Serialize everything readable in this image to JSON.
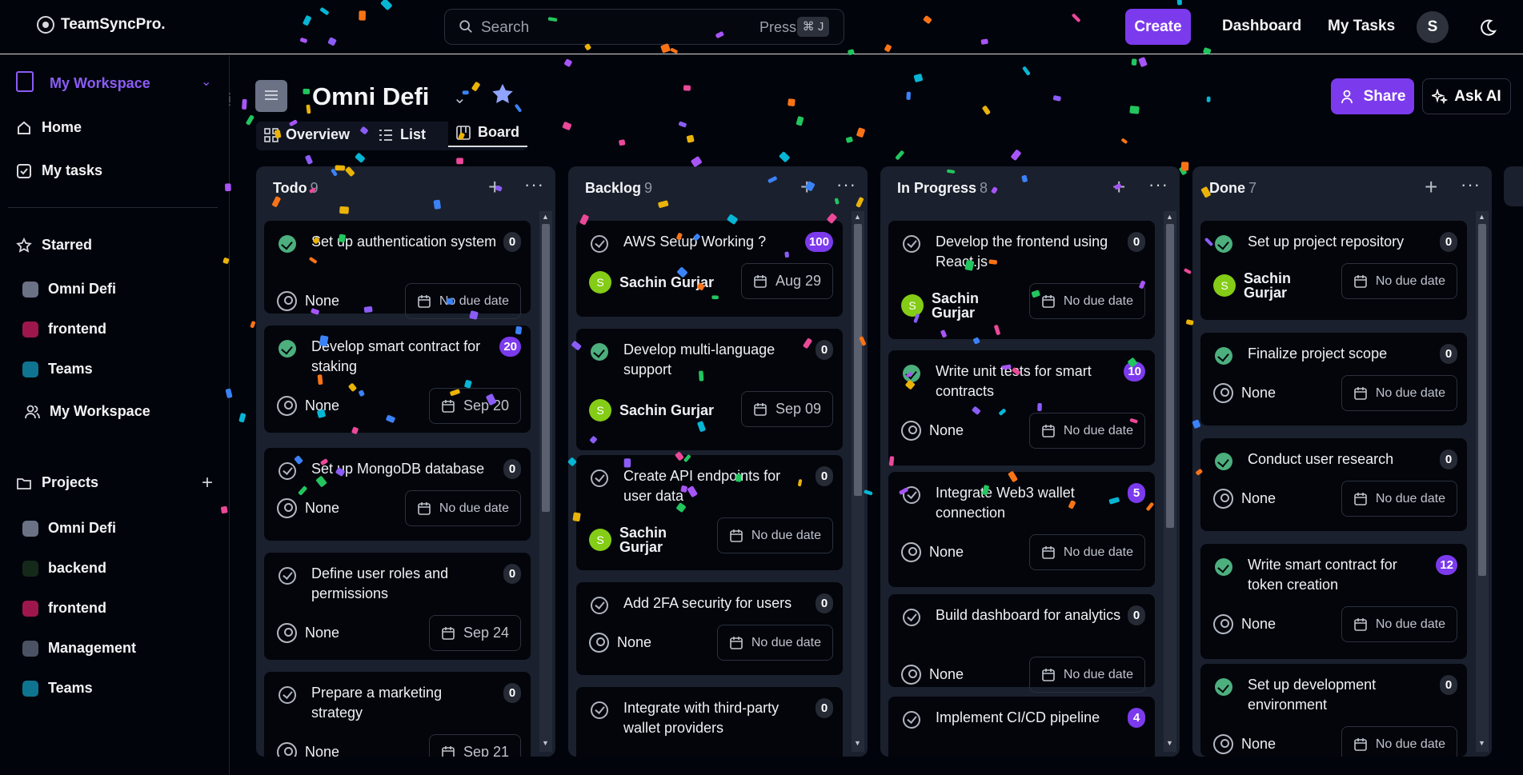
{
  "topbar": {
    "brand": "TeamSyncPro.",
    "search_placeholder": "Search",
    "press_label": "Press",
    "shortcut": "⌘ J",
    "create_label": "Create",
    "dashboard_label": "Dashboard",
    "my_tasks_label": "My Tasks",
    "avatar_initial": "S"
  },
  "sidebar": {
    "workspace_label": "My Workspace",
    "home_label": "Home",
    "my_tasks_label": "My tasks",
    "starred_label": "Starred",
    "starred_items": [
      {
        "label": "Omni Defi",
        "color": "#6b7286"
      },
      {
        "label": "frontend",
        "color": "#9d174d"
      },
      {
        "label": "Teams",
        "color": "#0e7490"
      }
    ],
    "my_workspace_label": "My Workspace",
    "projects_label": "Projects",
    "projects": [
      {
        "label": "Omni Defi",
        "color": "#6b7286"
      },
      {
        "label": "backend",
        "color": "#14291a"
      },
      {
        "label": "frontend",
        "color": "#9d174d"
      },
      {
        "label": "Management",
        "color": "#4b5263"
      },
      {
        "label": "Teams",
        "color": "#0e7490"
      }
    ]
  },
  "project": {
    "title": "Omni Defi",
    "views": [
      "Overview",
      "List",
      "Board"
    ],
    "active_view": "Board",
    "share_label": "Share",
    "ask_ai_label": "Ask AI"
  },
  "colors": {
    "accent": "#7c3aed",
    "done_check": "#4caf7d",
    "avatar_green": "#84cc16"
  },
  "columns": [
    {
      "name": "Todo",
      "count": "9",
      "cards": [
        {
          "title": "Set up authentication system",
          "done": true,
          "badge": "0",
          "badge_purple": false,
          "assignee": "None",
          "assignee_avatar": "",
          "due": "No due date"
        },
        {
          "title": "Develop smart contract for staking",
          "done": true,
          "badge": "20",
          "badge_purple": true,
          "assignee": "None",
          "assignee_avatar": "",
          "due": "Sep 20"
        },
        {
          "title": "Set up MongoDB database",
          "done": false,
          "badge": "0",
          "badge_purple": false,
          "assignee": "None",
          "assignee_avatar": "",
          "due": "No due date"
        },
        {
          "title": "Define user roles and permissions",
          "done": false,
          "badge": "0",
          "badge_purple": false,
          "assignee": "None",
          "assignee_avatar": "",
          "due": "Sep 24"
        },
        {
          "title": "Prepare a marketing strategy",
          "done": false,
          "badge": "0",
          "badge_purple": false,
          "assignee": "None",
          "assignee_avatar": "",
          "due": "Sep 21"
        }
      ]
    },
    {
      "name": "Backlog",
      "count": "9",
      "cards": [
        {
          "title": "AWS Setup Working ?",
          "done": false,
          "badge": "100",
          "badge_purple": true,
          "assignee": "Sachin Gurjar",
          "assignee_avatar": "S",
          "due": "Aug 29"
        },
        {
          "title": "Develop multi-language support",
          "done": true,
          "badge": "0",
          "badge_purple": false,
          "assignee": "Sachin Gurjar",
          "assignee_avatar": "S",
          "due": "Sep 09"
        },
        {
          "title": "Create API endpoints for user data",
          "done": false,
          "badge": "0",
          "badge_purple": false,
          "assignee": "Sachin Gurjar",
          "assignee_avatar": "S",
          "due": "No due date"
        },
        {
          "title": "Add 2FA security for users",
          "done": false,
          "badge": "0",
          "badge_purple": false,
          "assignee": "None",
          "assignee_avatar": "",
          "due": "No due date"
        },
        {
          "title": "Integrate with third-party wallet providers",
          "done": false,
          "badge": "0",
          "badge_purple": false,
          "assignee": "",
          "assignee_avatar": "",
          "due": ""
        }
      ]
    },
    {
      "name": "In Progress",
      "count": "8",
      "cards": [
        {
          "title": "Develop the frontend using React.js",
          "done": false,
          "badge": "0",
          "badge_purple": false,
          "assignee": "Sachin Gurjar",
          "assignee_avatar": "S",
          "due": "No due date"
        },
        {
          "title": "Write unit tests for smart contracts",
          "done": true,
          "badge": "10",
          "badge_purple": true,
          "assignee": "None",
          "assignee_avatar": "",
          "due": "No due date"
        },
        {
          "title": "Integrate Web3 wallet connection",
          "done": false,
          "badge": "5",
          "badge_purple": true,
          "assignee": "None",
          "assignee_avatar": "",
          "due": "No due date"
        },
        {
          "title": "Build dashboard for analytics",
          "done": false,
          "badge": "0",
          "badge_purple": false,
          "assignee": "None",
          "assignee_avatar": "",
          "due": "No due date"
        },
        {
          "title": "Implement CI/CD pipeline",
          "done": false,
          "badge": "4",
          "badge_purple": true,
          "assignee": "",
          "assignee_avatar": "",
          "due": ""
        }
      ]
    },
    {
      "name": "Done",
      "count": "7",
      "cards": [
        {
          "title": "Set up project repository",
          "done": true,
          "badge": "0",
          "badge_purple": false,
          "assignee": "Sachin Gurjar",
          "assignee_avatar": "S",
          "due": "No due date"
        },
        {
          "title": "Finalize project scope",
          "done": true,
          "badge": "0",
          "badge_purple": false,
          "assignee": "None",
          "assignee_avatar": "",
          "due": "No due date"
        },
        {
          "title": "Conduct user research",
          "done": true,
          "badge": "0",
          "badge_purple": false,
          "assignee": "None",
          "assignee_avatar": "",
          "due": "No due date"
        },
        {
          "title": "Write smart contract for token creation",
          "done": true,
          "badge": "12",
          "badge_purple": true,
          "assignee": "None",
          "assignee_avatar": "",
          "due": "No due date"
        },
        {
          "title": "Set up development environment",
          "done": true,
          "badge": "0",
          "badge_purple": false,
          "assignee": "None",
          "assignee_avatar": "",
          "due": "No due date"
        }
      ]
    }
  ]
}
